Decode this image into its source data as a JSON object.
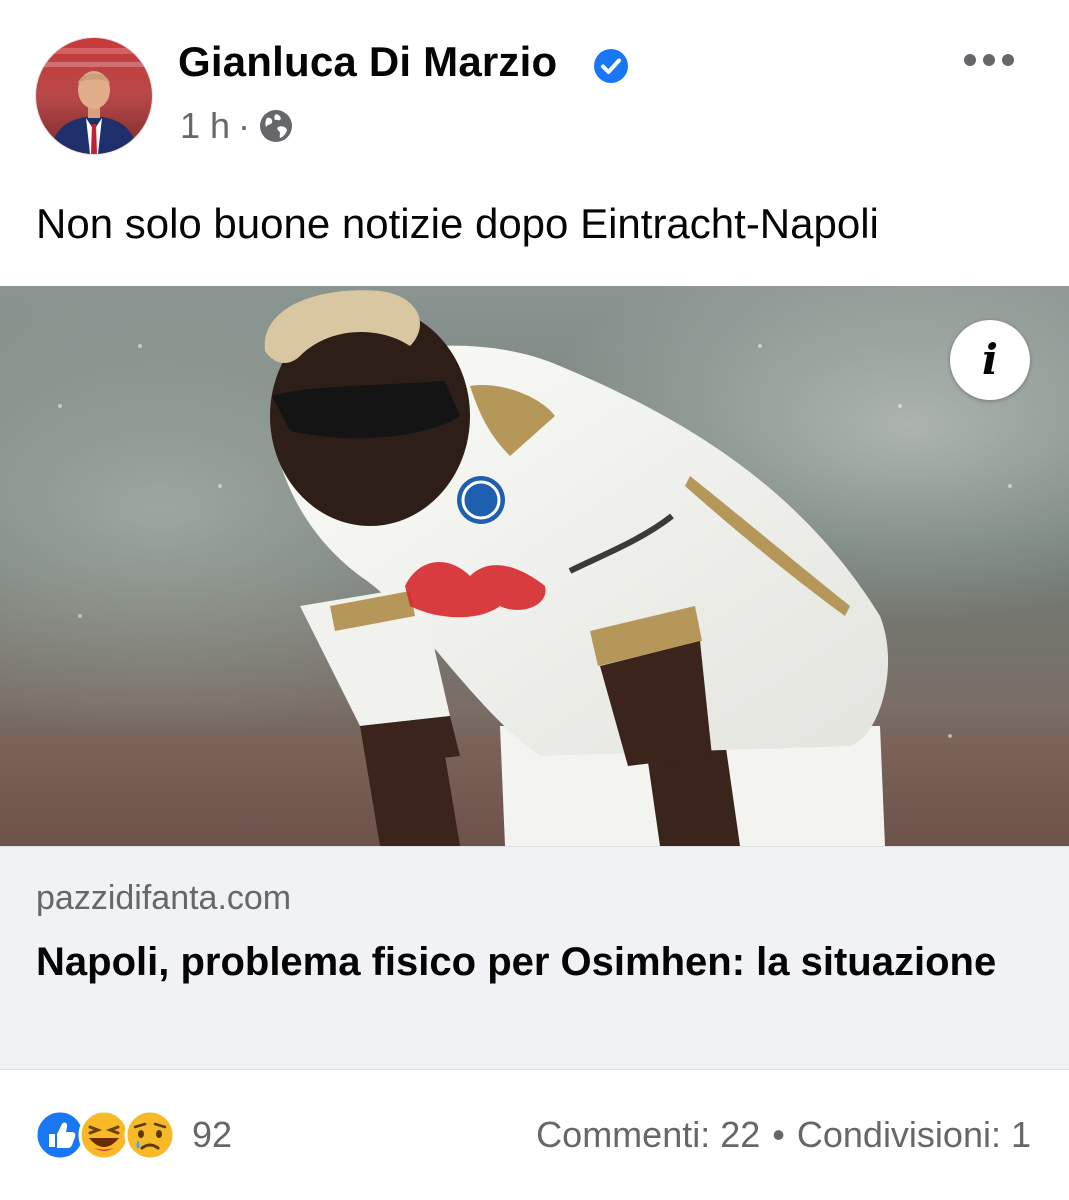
{
  "post": {
    "author": "Gianluca Di Marzio",
    "time": "1 h",
    "meta_separator": "·",
    "audience_icon": "globe-icon",
    "verified_icon": "verified-badge-icon",
    "more_icon": "more-options-icon",
    "text": "Non solo buone notizie dopo Eintracht-Napoli"
  },
  "link": {
    "info_glyph": "i",
    "domain": "pazzidifanta.com",
    "title": "Napoli, problema fisico per Osimhen: la situazione"
  },
  "reactions": {
    "icons": [
      "like-icon",
      "haha-icon",
      "sad-icon"
    ],
    "count": "92",
    "comments": "Commenti: 22",
    "separator": "•",
    "shares": "Condivisioni: 1"
  },
  "colors": {
    "facebook_blue": "#1877f2",
    "secondary_text": "#65676b",
    "link_background": "#f0f2f5"
  }
}
